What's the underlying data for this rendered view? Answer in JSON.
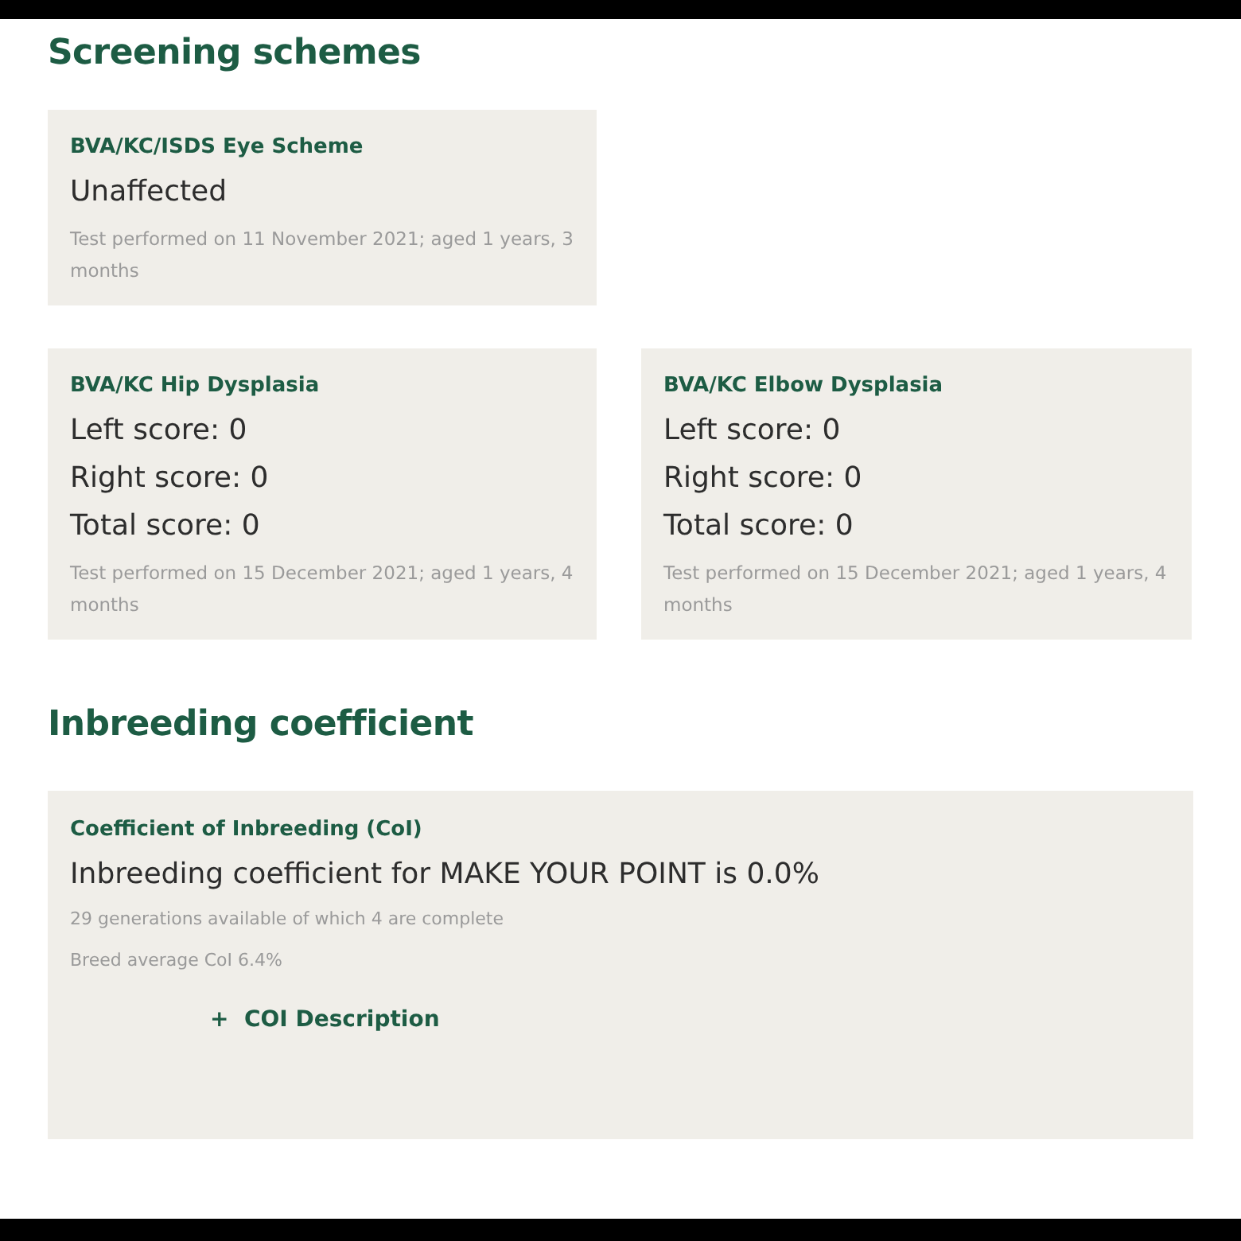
{
  "screening": {
    "heading": "Screening schemes",
    "schemes": [
      {
        "title": "BVA/KC/ISDS Eye Scheme",
        "results": [
          "Unaffected"
        ],
        "note": "Test performed on 11 November 2021; aged 1 years, 3 months"
      },
      {
        "title": "BVA/KC Hip Dysplasia",
        "results": [
          "Left score: 0",
          "Right score: 0",
          "Total score: 0"
        ],
        "note": "Test performed on 15 December 2021; aged 1 years, 4 months"
      },
      {
        "title": "BVA/KC Elbow Dysplasia",
        "results": [
          "Left score: 0",
          "Right score: 0",
          "Total score: 0"
        ],
        "note": "Test performed on 15 December 2021; aged 1 years, 4 months"
      }
    ]
  },
  "inbreeding": {
    "heading": "Inbreeding coefficient",
    "title": "Coefficient of Inbreeding (CoI)",
    "result": "Inbreeding coefficient for MAKE YOUR POINT is 0.0%",
    "notes": [
      "29 generations available of which 4 are complete",
      "Breed average CoI 6.4%"
    ],
    "link": "+  COI Description"
  }
}
